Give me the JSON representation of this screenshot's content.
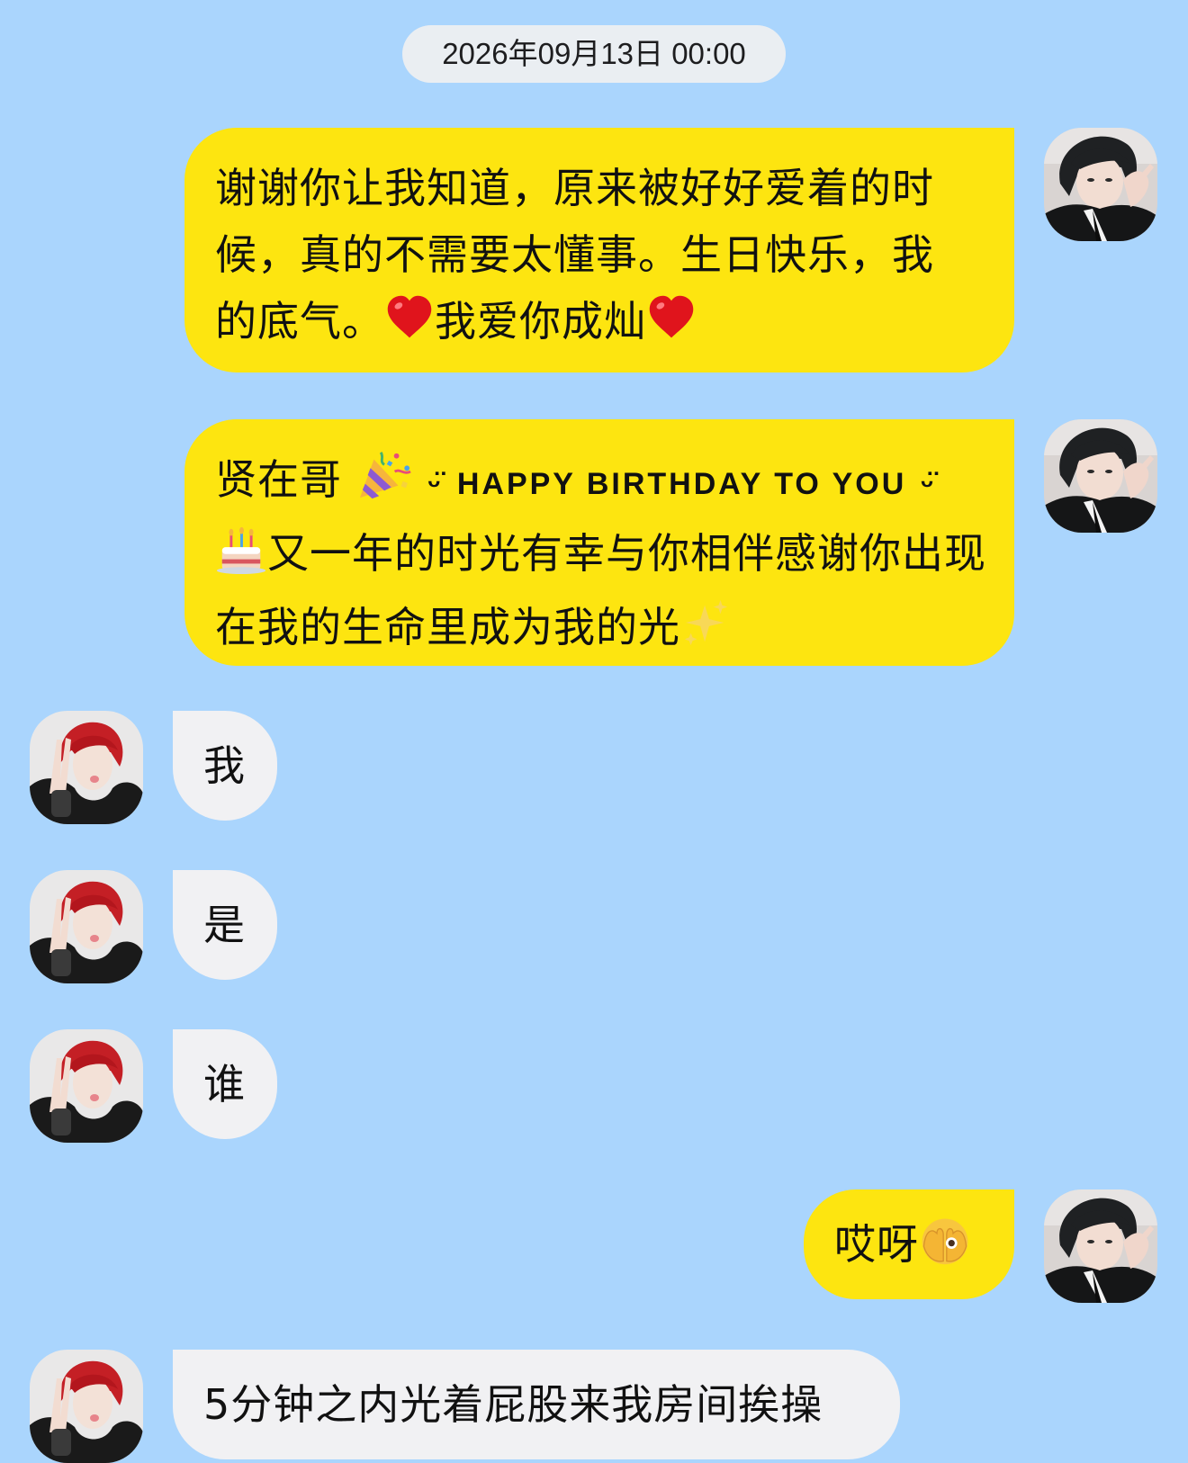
{
  "chat": {
    "timestamp": "2026年09月13日 00:00",
    "messages": [
      {
        "side": "right",
        "text_parts": [
          "谢谢你让我知道，原来被好好爱着的时候，真的不需要太懂事。生日快乐，我的底气。",
          "我爱你成灿"
        ],
        "emoji": [
          "heart-emoji",
          "heart-emoji"
        ]
      },
      {
        "side": "right",
        "text_parts": [
          "贤在哥",
          "HAPPY BIRTHDAY TO YOU",
          "又一年的时光有幸与你相伴感谢你出现在我的生命里成为我的光"
        ],
        "smile_mark": "ᵕ̈",
        "emoji": [
          "party-popper-emoji",
          "birthday-cake-emoji",
          "sparkles-emoji"
        ]
      },
      {
        "side": "left",
        "text": "我"
      },
      {
        "side": "left",
        "text": "是"
      },
      {
        "side": "left",
        "text": "谁"
      },
      {
        "side": "right",
        "text": "哎呀",
        "emoji": [
          "peeking-eye-emoji"
        ]
      },
      {
        "side": "left",
        "text": "5分钟之内光着屁股来我房间挨操"
      }
    ]
  },
  "colors": {
    "background": "#aad5fd",
    "sent_bubble": "#fde510",
    "received_bubble": "#f1f1f3",
    "timestamp_pill": "#eaeef2"
  }
}
